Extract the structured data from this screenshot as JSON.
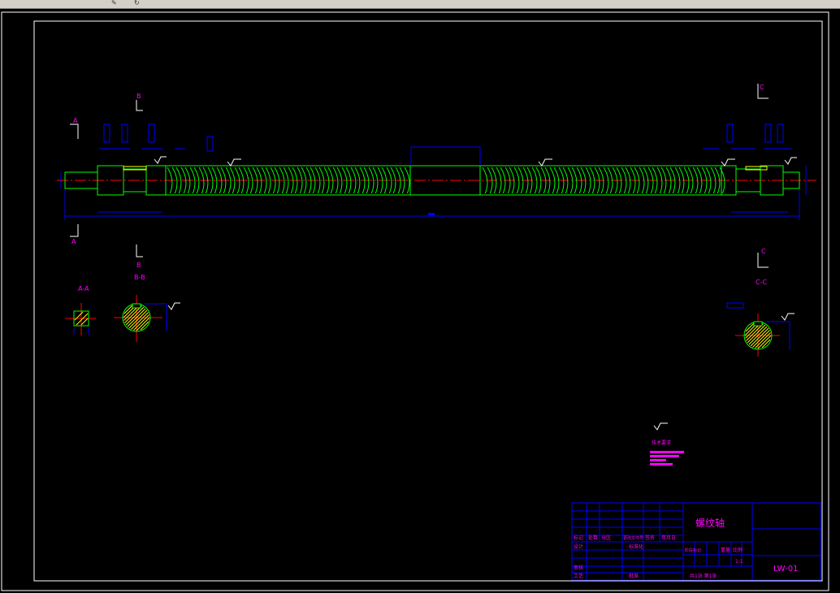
{
  "window": {
    "toolbar_icons": [
      "pencil-icon",
      "refresh-icon"
    ]
  },
  "drawing": {
    "title": "螺纹轴",
    "drawing_number": "LW-01",
    "scale": "1:1",
    "sheet_info": "共1张  第1张",
    "section_labels": {
      "a_top": "A",
      "a_bottom": "A",
      "b_top": "B",
      "b_bottom": "B",
      "c_top": "C",
      "c_bottom": "C",
      "view_aa": "A-A",
      "view_bb": "B-B",
      "view_cc": "C-C"
    },
    "title_block": {
      "row_labels_left": [
        "标记",
        "处数",
        "分区",
        "更改文件号",
        "签名",
        "年月日"
      ],
      "design": "设计",
      "review": "审核",
      "process": "工艺",
      "standard": "标准化",
      "approve": "批准",
      "stage_labels": [
        "阶段标记",
        "重量",
        "比例"
      ]
    },
    "tech_req_title": "技术要求"
  },
  "colors": {
    "background": "#000000",
    "frame": "#ffffff",
    "part_outline": "#00ff00",
    "dimension": "#0000ff",
    "annotation": "#ff00ff",
    "centerline": "#ff0000",
    "hatch": "#ffff00",
    "titleblock_line": "#0000ff",
    "titleblock_text": "#ff00ff"
  }
}
